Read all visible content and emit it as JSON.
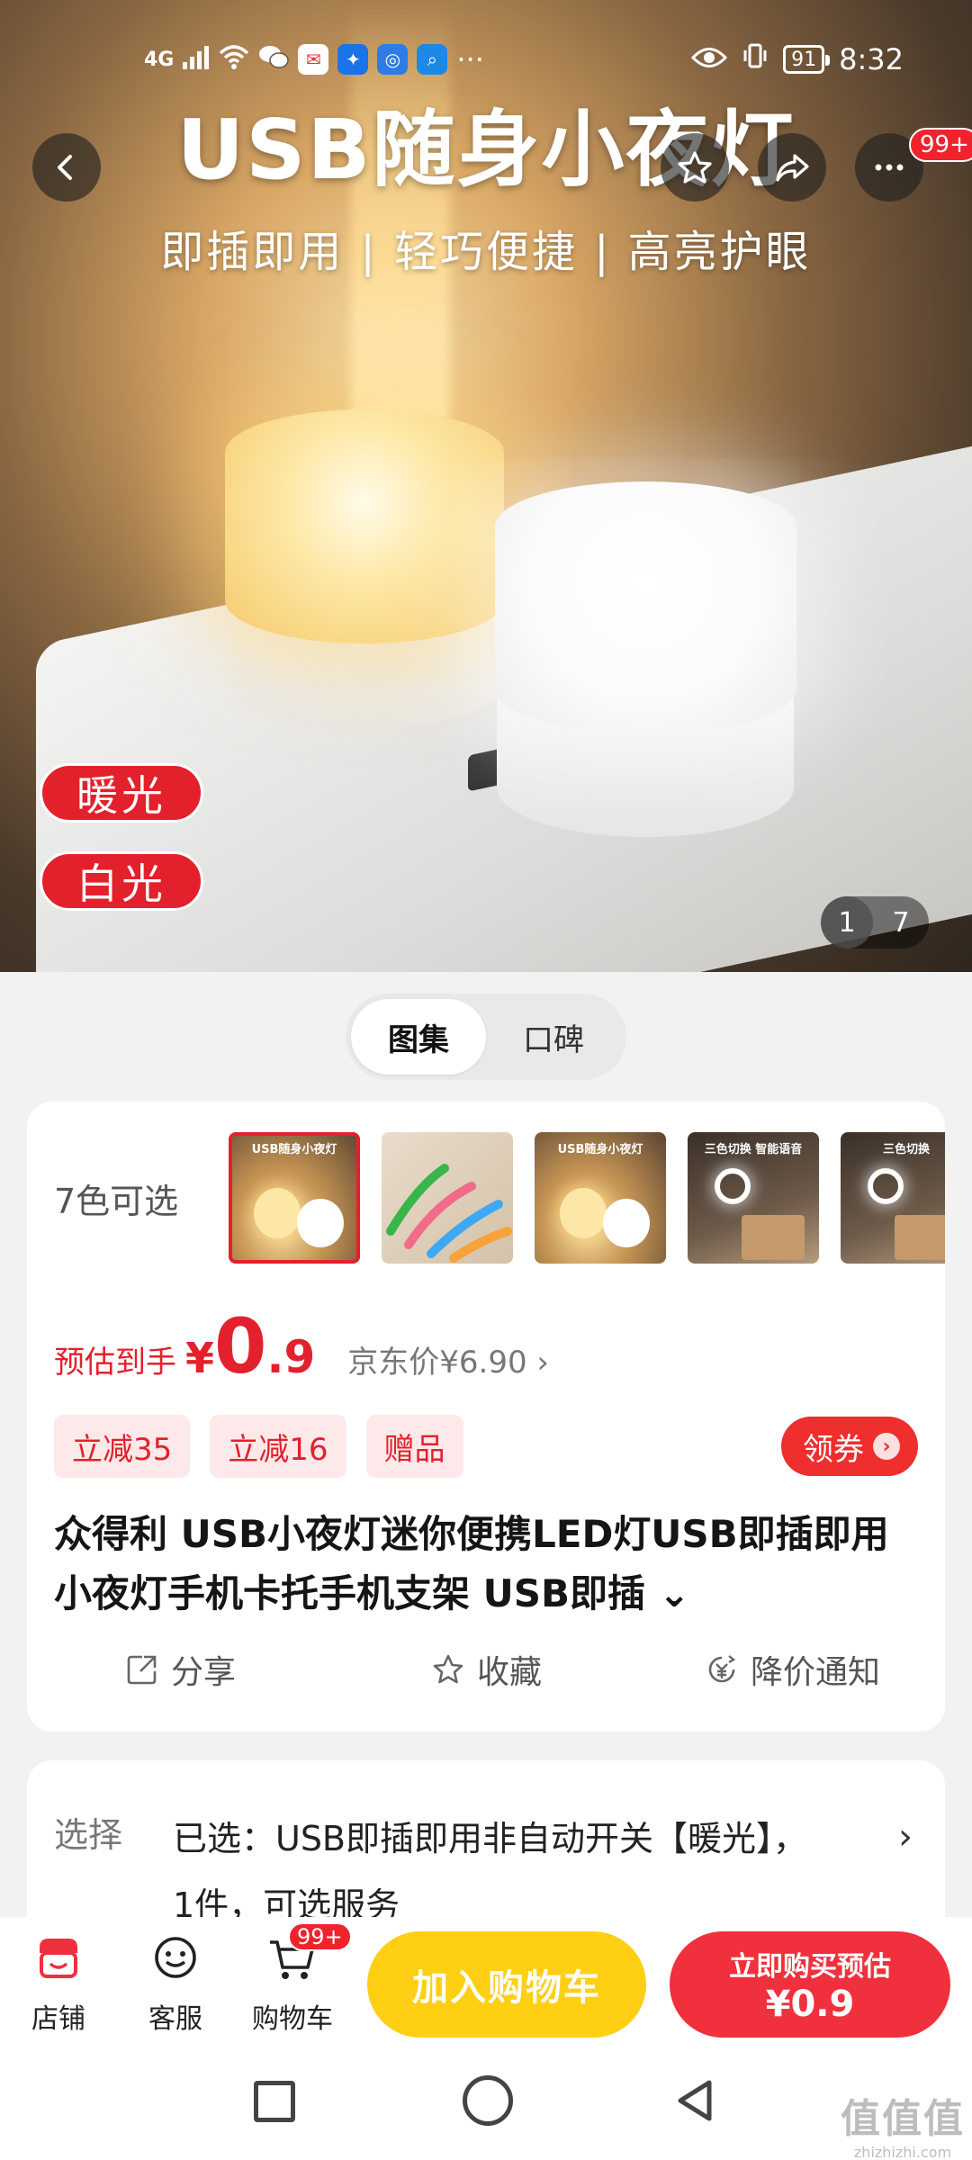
{
  "status_bar": {
    "signal": "4G",
    "battery": "91",
    "time": "8:32",
    "more": "···"
  },
  "hero": {
    "title": "USB随身小夜灯",
    "subtitle": "即插即用 | 轻巧便捷 | 高亮护眼",
    "tags": [
      "暖光",
      "白光"
    ],
    "badge": "99+",
    "image_index": "1",
    "image_total": "7"
  },
  "mode_tabs": [
    "图集",
    "口碑"
  ],
  "colors": {
    "label": "7色可选",
    "thumb_titles": [
      "USB随身小夜灯",
      "",
      "USB随身小夜灯",
      "三色切换 智能语音",
      "三色切换"
    ]
  },
  "price": {
    "label": "预估到手",
    "currency": "¥",
    "integer": "0",
    "decimal": ".9",
    "jd_price": "京东价¥6.90",
    "jd_arrow": "›"
  },
  "promos": [
    "立减35",
    "立减16",
    "赠品"
  ],
  "coupon": "领券",
  "product_title": "众得利  USB小夜灯迷你便携LED灯USB即插即用小夜灯手机卡托手机支架 USB即插",
  "title_expand": "⌄",
  "actions": {
    "share": "分享",
    "favorite": "收藏",
    "price_alert": "降价通知"
  },
  "selection": {
    "label": "选择",
    "value": "已选：USB即插即用非自动开关【暖光】，1件，可选服务"
  },
  "bottom_bar": {
    "shop": "店铺",
    "service": "客服",
    "cart": "购物车",
    "cart_badge": "99+",
    "add_to_cart": "加入购物车",
    "buy_now_line1": "立即购买预估",
    "buy_now_line2": "¥0.9"
  },
  "watermark": {
    "logo": "值值值",
    "url": "zhizhizhi.com"
  },
  "theme": {
    "accent_red": "#e3212c",
    "cart_yellow": "#ffcf14"
  }
}
